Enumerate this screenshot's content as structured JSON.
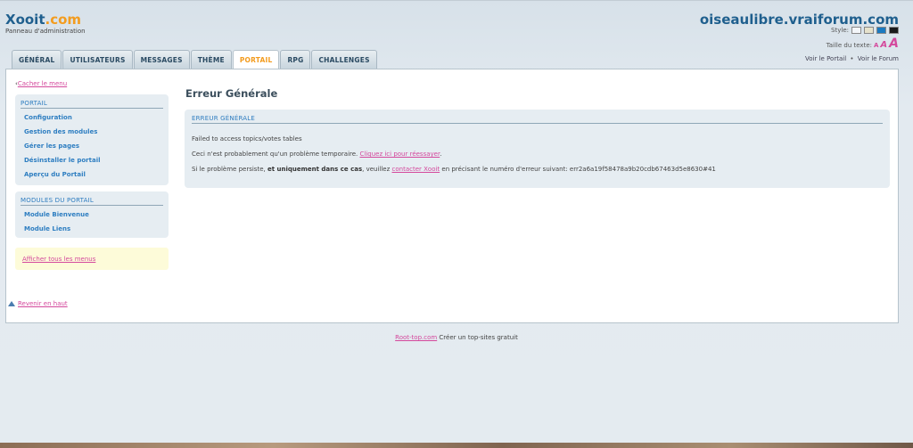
{
  "header": {
    "brand_main": "Xooit",
    "brand_suffix": ".com",
    "brand_subtitle": "Panneau d'administration",
    "site_name": "oiseaulibre.vraiforum.com",
    "style_label": "Style:",
    "text_size_label": "Taille du texte:",
    "text_size_small": "A",
    "text_size_medium": "A",
    "text_size_large": "A",
    "style_swatches": [
      "#f3f6f9",
      "#e6e2cc",
      "#1b7ac0",
      "#1a1a1a"
    ]
  },
  "tabs": [
    {
      "label": "GÉNÉRAL"
    },
    {
      "label": "UTILISATEURS"
    },
    {
      "label": "MESSAGES"
    },
    {
      "label": "THÈME"
    },
    {
      "label": "PORTAIL"
    },
    {
      "label": "RPG"
    },
    {
      "label": "CHALLENGES"
    }
  ],
  "active_tab": "PORTAIL",
  "view_links": {
    "portal": "Voir le Portail",
    "separator": "•",
    "forum": "Voir le Forum"
  },
  "sidebar": {
    "hide_menu_arrow": "‹",
    "hide_menu": "Cacher le menu",
    "portail_title": "PORTAIL",
    "portail_items": [
      {
        "label": "Configuration"
      },
      {
        "label": "Gestion des modules"
      },
      {
        "label": "Gérer les pages"
      },
      {
        "label": "Désinstaller le portail"
      },
      {
        "label": "Aperçu du Portail"
      }
    ],
    "modules_title": "MODULES DU PORTAIL",
    "modules_items": [
      {
        "label": "Module Bienvenue"
      },
      {
        "label": "Module Liens"
      }
    ],
    "show_all_menus": "Afficher tous les menus",
    "back_to_top": "Revenir en haut"
  },
  "main": {
    "title": "Erreur Générale",
    "box_title": "ERREUR GÉNÉRALE",
    "line1": "Failed to access topics/votes tables",
    "line2_prefix": "Ceci n'est probablement qu'un problème temporaire. ",
    "line2_link": "Cliquez ici pour réessayer",
    "line2_suffix": ".",
    "line3_prefix": "Si le problème persiste, ",
    "line3_bold": "et uniquement dans ce cas",
    "line3_mid": ", veuillez ",
    "line3_link": "contacter Xooit",
    "line3_suffix": " en précisant le numéro d'erreur suivant: err2a6a19f58478a9b20cdb67463d5e8630#41"
  },
  "footer": {
    "link": "Root-top.com",
    "text": " Créer un top-sites gratuit"
  },
  "colors": {
    "brand_blue": "#1f5f8e",
    "brand_orange": "#f39c1f",
    "link_pink": "#d4489c",
    "menu_blue": "#2e7ec1"
  }
}
